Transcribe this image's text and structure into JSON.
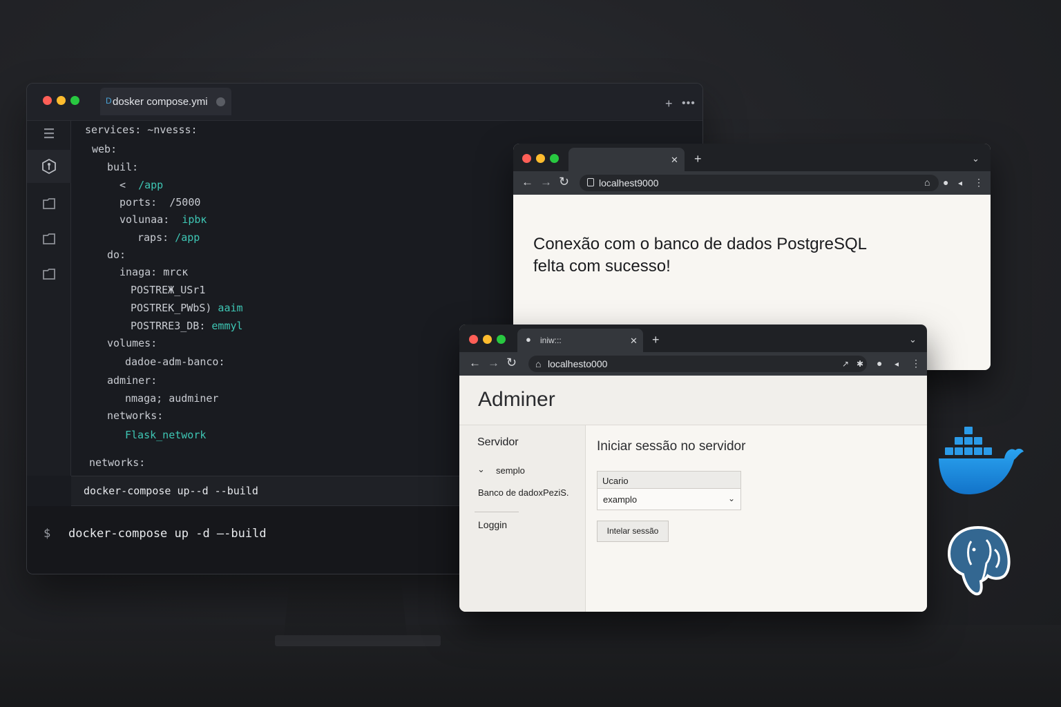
{
  "editor": {
    "tab_label": "dosker compose.ymi",
    "code_lines": [
      {
        "indent": 0,
        "key": "services:",
        "value": "~nvesss:",
        "value_color": "plain"
      },
      {
        "indent": 10,
        "key": "web:",
        "value": "",
        "value_color": "plain"
      },
      {
        "indent": 32,
        "key": "buil:",
        "value": "",
        "value_color": "plain"
      },
      {
        "indent": 50,
        "key": "<",
        "value": " /app",
        "value_color": "teal"
      },
      {
        "indent": 50,
        "key": "ports:",
        "value": " /5000",
        "value_color": "plain"
      },
      {
        "indent": 50,
        "key": "volunaa:",
        "value": " ipbк",
        "value_color": "teal"
      },
      {
        "indent": 76,
        "key": "raps:",
        "value": "/app",
        "value_color": "teal"
      },
      {
        "indent": 32,
        "key": "do:",
        "value": "",
        "value_color": "plain"
      },
      {
        "indent": 50,
        "key": "inaga:",
        "value": "mrcк",
        "value_color": "plain"
      },
      {
        "indent": 66,
        "key": "POSTREЖ_USr1",
        "value": "",
        "value_color": "plain"
      },
      {
        "indent": 66,
        "key": "POSTREK_PWbS)",
        "value": "aaim",
        "value_color": "teal"
      },
      {
        "indent": 66,
        "key": "POSTRRE3_DB:",
        "value": "emmyl",
        "value_color": "teal"
      },
      {
        "indent": 32,
        "key": "volumes:",
        "value": "",
        "value_color": "plain"
      },
      {
        "indent": 58,
        "key": "dadoe-adm-banco:",
        "value": "",
        "value_color": "plain"
      },
      {
        "indent": 32,
        "key": "adminer:",
        "value": "",
        "value_color": "plain"
      },
      {
        "indent": 58,
        "key": "nmaga;",
        "value": "audminer",
        "value_color": "plain"
      },
      {
        "indent": 32,
        "key": "networks:",
        "value": "",
        "value_color": "plain"
      },
      {
        "indent": 58,
        "key": "",
        "value": "Flask_network",
        "value_color": "teal"
      },
      {
        "indent": 6,
        "key": "networks:",
        "value": "",
        "value_color": "plain"
      }
    ],
    "command_bar": "docker-compose up--d --build",
    "terminal_prompt": "$",
    "terminal_command": "docker-compose up -d —-build"
  },
  "browser_app": {
    "url": "localhest9000",
    "message_line1": "Conexão com o banco de dados PostgreSQL",
    "message_line2": "felta com sucesso!"
  },
  "browser_adminer": {
    "tab_title": "iniw:::",
    "url": "localhesto000",
    "title": "Adminer",
    "sidebar_title": "Servidor",
    "sidebar_item": "semplo",
    "sidebar_db": "Banco de dadoxPeziS.",
    "sidebar_login": "Loggin",
    "main_title": "Iniciar sessão no servidor",
    "field_label": "Ucario",
    "select_value": "examplo",
    "button_label": "Intelar sessão"
  },
  "colors": {
    "accent_teal": "#3ec6b4",
    "docker_blue": "#1d8fe0",
    "postgres_blue": "#336791",
    "traffic_red": "#ff5f57",
    "traffic_yellow": "#febc2e",
    "traffic_green": "#28c840"
  },
  "icons": [
    "menu-icon",
    "git-icon",
    "folder-icon",
    "file-lock-icon",
    "back-icon",
    "forward-icon",
    "reload-icon",
    "home-icon",
    "profile-icon",
    "chevron-down-icon",
    "docker-logo",
    "postgresql-logo"
  ]
}
